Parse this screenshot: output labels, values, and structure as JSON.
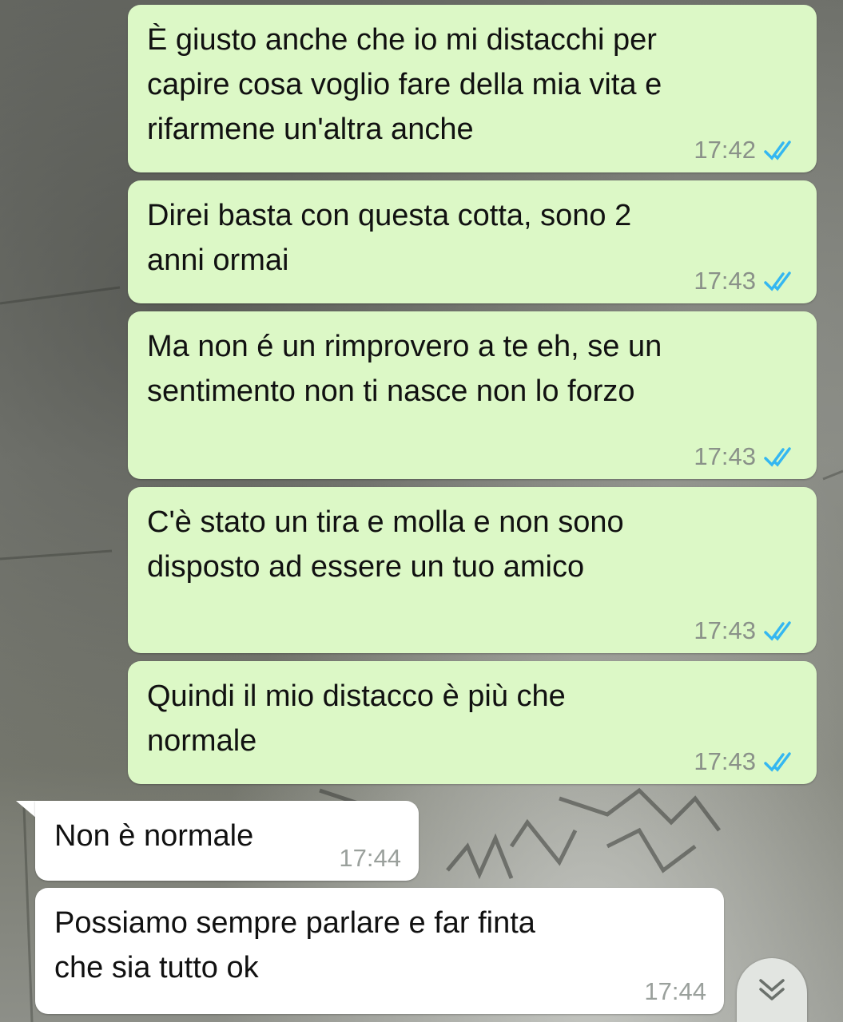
{
  "conversation": {
    "messages": [
      {
        "direction": "outgoing",
        "text": "È giusto anche che io mi distacchi per\ncapire cosa voglio fare della mia vita e\nrifarmene un'altra anche",
        "time": "17:42",
        "status": "read"
      },
      {
        "direction": "outgoing",
        "text": "Direi basta con questa cotta, sono 2\nanni ormai",
        "time": "17:43",
        "status": "read"
      },
      {
        "direction": "outgoing",
        "text": "Ma non é un rimprovero a te eh, se un\nsentimento non ti nasce non lo forzo",
        "time": "17:43",
        "status": "read"
      },
      {
        "direction": "outgoing",
        "text": "C'è stato un tira e molla e non sono\ndisposto ad essere un tuo amico",
        "time": "17:43",
        "status": "read"
      },
      {
        "direction": "outgoing",
        "text": "Quindi il mio distacco è più che\nnormale",
        "time": "17:43",
        "status": "read"
      },
      {
        "direction": "incoming",
        "text": "Non è normale",
        "time": "17:44"
      },
      {
        "direction": "incoming",
        "text": "Possiamo sempre parlare e far finta\nche sia tutto ok",
        "time": "17:44"
      }
    ]
  },
  "colors": {
    "outgoing_bubble": "#dcf8c6",
    "incoming_bubble": "#ffffff",
    "read_ticks": "#34b7f1",
    "timestamp": "#8a9189"
  },
  "icons": {
    "read_status": "double-check-icon",
    "scroll_down": "double-chevron-down-icon"
  }
}
